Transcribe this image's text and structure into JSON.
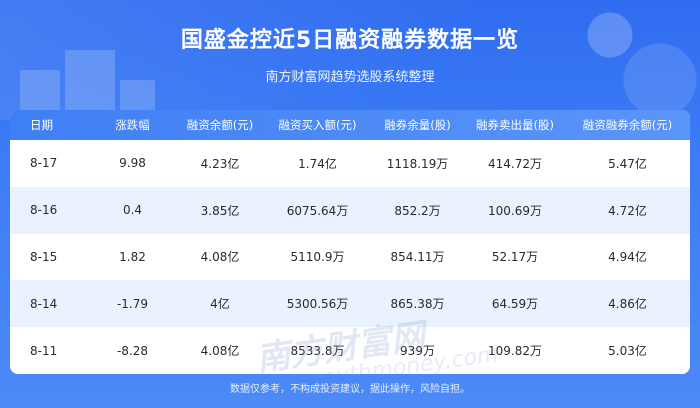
{
  "header": {
    "title": "国盛金控近5日融资融券数据一览",
    "subtitle": "南方财富网趋势选股系统整理"
  },
  "table": {
    "columns": [
      "日期",
      "涨跌幅",
      "融资余额(元)",
      "融资买入额(元)",
      "融券余量(股)",
      "融券卖出量(股)",
      "融资融券余额(元)"
    ],
    "rows": [
      [
        "8-17",
        "9.98",
        "4.23亿",
        "1.74亿",
        "1118.19万",
        "414.72万",
        "5.47亿"
      ],
      [
        "8-16",
        "0.4",
        "3.85亿",
        "6075.64万",
        "852.2万",
        "100.69万",
        "4.72亿"
      ],
      [
        "8-15",
        "1.82",
        "4.08亿",
        "5110.9万",
        "854.11万",
        "52.17万",
        "4.94亿"
      ],
      [
        "8-14",
        "-1.79",
        "4亿",
        "5300.56万",
        "865.38万",
        "64.59万",
        "4.86亿"
      ],
      [
        "8-11",
        "-8.28",
        "4.08亿",
        "8533.8万",
        "939万",
        "109.82万",
        "5.03亿"
      ]
    ]
  },
  "watermark": {
    "text": "南方财富网",
    "sub": "southmoney.com"
  },
  "footer": {
    "disclaimer": "数据仅参考，不构成投资建议，据此操作，风险自担。"
  }
}
